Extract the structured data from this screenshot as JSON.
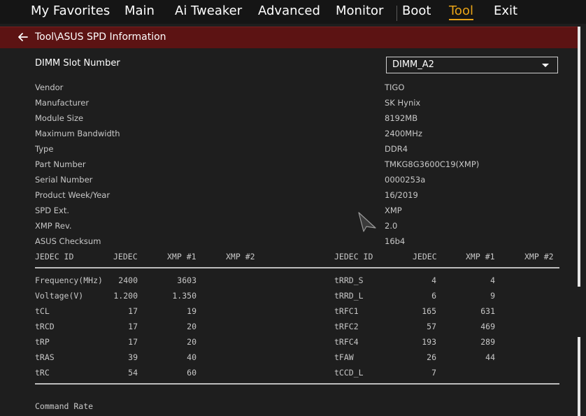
{
  "menu": [
    {
      "label": "My Favorites",
      "active": false
    },
    {
      "label": "Main",
      "active": false
    },
    {
      "label": "Ai Tweaker",
      "active": false
    },
    {
      "label": "Advanced",
      "active": false
    },
    {
      "label": "Monitor",
      "active": false
    },
    {
      "label": "Boot",
      "active": false
    },
    {
      "label": "Tool",
      "active": true
    },
    {
      "label": "Exit",
      "active": false
    }
  ],
  "breadcrumb": "Tool\\ASUS SPD Information",
  "dimm": {
    "label": "DIMM Slot Number",
    "selected": "DIMM_A2"
  },
  "info": [
    {
      "label": "Vendor",
      "value": "TIGO"
    },
    {
      "label": "Manufacturer",
      "value": "SK Hynix"
    },
    {
      "label": "Module Size",
      "value": "8192MB"
    },
    {
      "label": "Maximum Bandwidth",
      "value": "2400MHz"
    },
    {
      "label": "Type",
      "value": "DDR4"
    },
    {
      "label": "Part Number",
      "value": "TMKG8G3600C19(XMP)"
    },
    {
      "label": "Serial Number",
      "value": "0000253a"
    },
    {
      "label": "Product Week/Year",
      "value": "16/2019"
    },
    {
      "label": "SPD Ext.",
      "value": "XMP"
    },
    {
      "label": "XMP Rev.",
      "value": "2.0"
    },
    {
      "label": "ASUS Checksum",
      "value": "16b4"
    }
  ],
  "table": {
    "left_headers": [
      "JEDEC ID",
      "JEDEC",
      "XMP #1",
      "XMP #2"
    ],
    "right_headers": [
      "JEDEC ID",
      "JEDEC",
      "XMP #1",
      "XMP #2"
    ],
    "left_rows": [
      [
        "Frequency(MHz)",
        "2400",
        "3603",
        ""
      ],
      [
        "Voltage(V)",
        "1.200",
        "1.350",
        ""
      ],
      [
        "tCL",
        "17",
        "19",
        ""
      ],
      [
        "tRCD",
        "17",
        "20",
        ""
      ],
      [
        "tRP",
        "17",
        "20",
        ""
      ],
      [
        "tRAS",
        "39",
        "40",
        ""
      ],
      [
        "tRC",
        "54",
        "60",
        ""
      ]
    ],
    "right_rows": [
      [
        "tRRD_S",
        "4",
        "4",
        ""
      ],
      [
        "tRRD_L",
        "6",
        "9",
        ""
      ],
      [
        "tRFC1",
        "165",
        "631",
        ""
      ],
      [
        "tRFC2",
        "57",
        "469",
        ""
      ],
      [
        "tRFC4",
        "193",
        "289",
        ""
      ],
      [
        "tFAW",
        "26",
        "44",
        ""
      ],
      [
        "tCCD_L",
        "7",
        "",
        ""
      ]
    ]
  },
  "footer_label": "Command Rate",
  "colors": {
    "accent": "#e8a317",
    "breadcrumb_bg": "#5c1313",
    "background": "#1e1e1e"
  }
}
